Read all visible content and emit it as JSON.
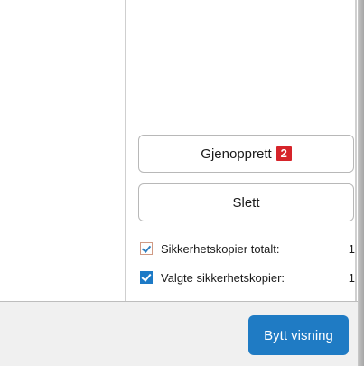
{
  "actions": {
    "restore_label": "Gjenopprett",
    "restore_badge": "2",
    "delete_label": "Slett"
  },
  "stats": {
    "total_label": "Sikkerhetskopier totalt:",
    "total_value": "1",
    "selected_label": "Valgte sikkerhetskopier:",
    "selected_value": "1"
  },
  "footer": {
    "switch_view_label": "Bytt visning"
  },
  "colors": {
    "accent": "#1f7bc4",
    "badge": "#d6242a"
  },
  "icons": {
    "total_icon": "backup-check-icon",
    "selected_icon": "checkbox-checked-icon"
  }
}
